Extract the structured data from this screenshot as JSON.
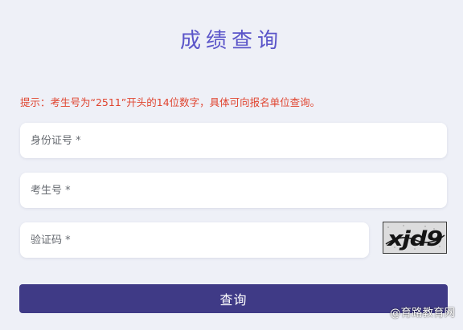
{
  "page": {
    "title": "成绩查询",
    "hint": "提示：考生号为“2511”开头的14位数字，具体可向报名单位查询。"
  },
  "form": {
    "id_card_placeholder": "身份证号 *",
    "exam_number_placeholder": "考生号 *",
    "captcha_placeholder": "验证码 *",
    "captcha_image_text": "xjd9",
    "submit_label": "查询"
  },
  "watermark": "@育路教育网",
  "colors": {
    "title": "#5b55c9",
    "hint": "#e0442f",
    "submit_bg": "#3f3a86",
    "page_bg": "#eef0f7"
  }
}
